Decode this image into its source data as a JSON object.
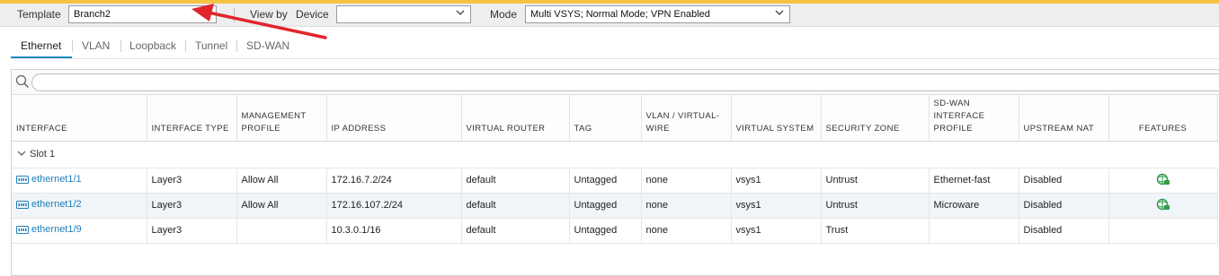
{
  "context_bar": {
    "template_label": "Template",
    "template_value": "Branch2",
    "view_by_label": "View by",
    "device_label": "Device",
    "device_value": "",
    "mode_label": "Mode",
    "mode_value": "Multi VSYS; Normal Mode; VPN Enabled"
  },
  "tabs": [
    {
      "label": "Ethernet",
      "active": true
    },
    {
      "label": "VLAN",
      "active": false
    },
    {
      "label": "Loopback",
      "active": false
    },
    {
      "label": "Tunnel",
      "active": false
    },
    {
      "label": "SD-WAN",
      "active": false
    }
  ],
  "search": {
    "placeholder": ""
  },
  "columns": {
    "interface": "INTERFACE",
    "interface_type": "INTERFACE TYPE",
    "management_profile_1": "MANAGEMENT",
    "management_profile_2": "PROFILE",
    "ip_address": "IP ADDRESS",
    "virtual_router": "VIRTUAL ROUTER",
    "tag": "TAG",
    "vlan_1": "VLAN / VIRTUAL-",
    "vlan_2": "WIRE",
    "virtual_system": "VIRTUAL SYSTEM",
    "security_zone": "SECURITY ZONE",
    "sdwan_1": "SD-WAN",
    "sdwan_2": "INTERFACE",
    "sdwan_3": "PROFILE",
    "upstream_nat": "UPSTREAM NAT",
    "features": "FEATURES"
  },
  "group": {
    "label": "Slot 1"
  },
  "rows": [
    {
      "interface": "ethernet1/1",
      "type": "Layer3",
      "mgmt": "Allow All",
      "ip": "172.16.7.2/24",
      "vr": "default",
      "tag": "Untagged",
      "vlan": "none",
      "vsys": "vsys1",
      "zone": "Untrust",
      "sdwan": "Ethernet-fast",
      "nat": "Disabled",
      "feature_icon": "globe-feature-icon"
    },
    {
      "interface": "ethernet1/2",
      "type": "Layer3",
      "mgmt": "Allow All",
      "ip": "172.16.107.2/24",
      "vr": "default",
      "tag": "Untagged",
      "vlan": "none",
      "vsys": "vsys1",
      "zone": "Untrust",
      "sdwan": "Microware",
      "nat": "Disabled",
      "feature_icon": "globe-feature-icon"
    },
    {
      "interface": "ethernet1/9",
      "type": "Layer3",
      "mgmt": "",
      "ip": "10.3.0.1/16",
      "vr": "default",
      "tag": "Untagged",
      "vlan": "none",
      "vsys": "vsys1",
      "zone": "Trust",
      "sdwan": "",
      "nat": "Disabled",
      "feature_icon": ""
    }
  ],
  "colors": {
    "accent_bar": "#f6c244",
    "link": "#1e7fb8",
    "active_tab": "#1a8dc2",
    "annotation_arrow": "#e0252b",
    "feature_icon": "#2e9b4a"
  }
}
